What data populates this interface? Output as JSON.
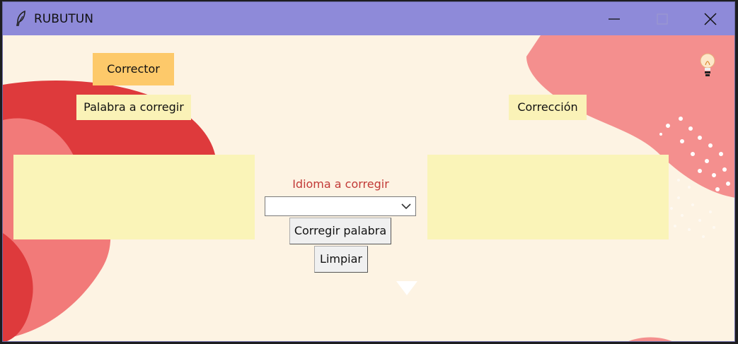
{
  "window": {
    "title": "RUBUTUN"
  },
  "main": {
    "corrector_label": "Corrector",
    "input_label": "Palabra a corregir",
    "output_label": "Corrección",
    "language_label": "Idioma a corregir",
    "language_value": "",
    "correct_button": "Corregir palabra",
    "clear_button": "Limpiar"
  },
  "colors": {
    "titlebar": "#8e8ad9",
    "background": "#fdf3e3",
    "accent_button": "#fdc96a",
    "textbox": "#faf4b8",
    "language_label": "#c23a37"
  },
  "icons": [
    "feather-icon",
    "minimize-icon",
    "maximize-icon",
    "close-icon",
    "chevron-down-icon",
    "lightbulb-icon",
    "down-triangle-icon"
  ]
}
